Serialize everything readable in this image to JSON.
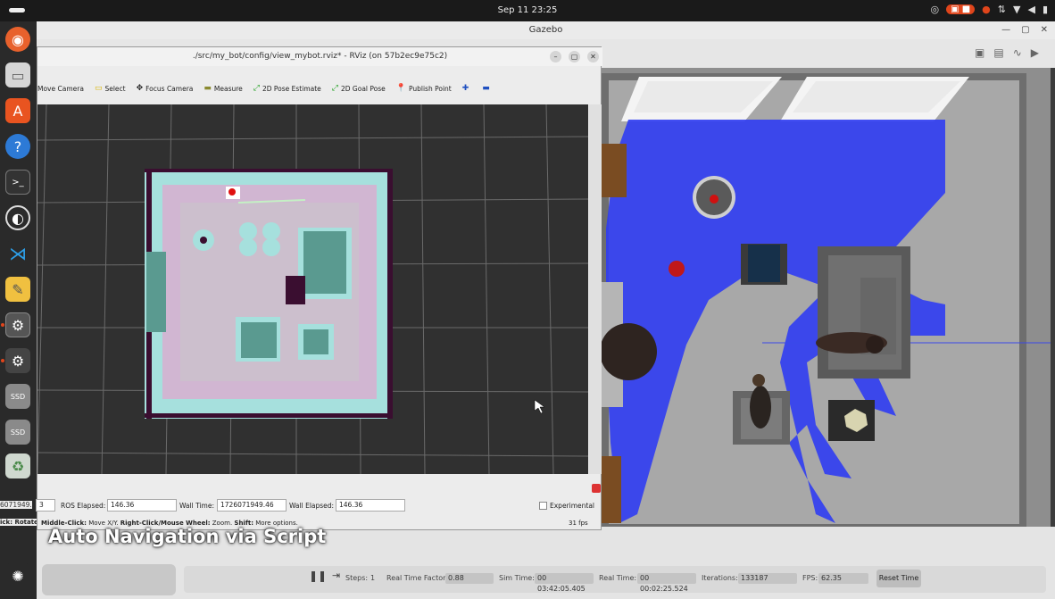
{
  "system": {
    "clock": "Sep 11  23:25",
    "tray_icons": [
      "chrome-icon",
      "screen-record-icon",
      "mic-icon",
      "network-icon",
      "wifi-icon",
      "volume-icon",
      "battery-icon"
    ]
  },
  "dock": {
    "apps": [
      "firefox-icon",
      "files-icon",
      "app-center-icon",
      "help-icon",
      "terminal-icon",
      "obs-icon",
      "vscode-icon",
      "text-editor-icon",
      "settings-icon",
      "settings-icon-2",
      "ssd-drive-icon",
      "ssd-drive-icon-2",
      "trash-icon",
      "ubuntu-apps-icon"
    ],
    "ssd_label": "SSD"
  },
  "gazebo": {
    "title": "Gazebo",
    "bottom_bar": {
      "steps_label": "Steps:",
      "steps_value": "1",
      "rtf_label": "Real Time Factor:",
      "rtf_value": "0.88",
      "sim_time_label": "Sim Time:",
      "sim_time_value": "00 03:42:05.405",
      "real_time_label": "Real Time:",
      "real_time_value": "00 00:02:25.524",
      "iterations_label": "Iterations:",
      "iterations_value": "133187",
      "fps_label": "FPS:",
      "fps_value": "62.35",
      "reset_label": "Reset Time"
    }
  },
  "rviz": {
    "title": "./src/my_bot/config/view_mybot.rviz* - RViz (on 57b2ec9e75c2)",
    "tools": [
      {
        "icon": "move-camera-icon",
        "label": "Move Camera"
      },
      {
        "icon": "select-icon",
        "label": "Select"
      },
      {
        "icon": "focus-camera-icon",
        "label": "Focus Camera"
      },
      {
        "icon": "measure-icon",
        "label": "Measure"
      },
      {
        "icon": "pose-estimate-icon",
        "label": "2D Pose Estimate"
      },
      {
        "icon": "goal-pose-icon",
        "label": "2D Goal Pose"
      },
      {
        "icon": "publish-point-icon",
        "label": "Publish Point"
      }
    ],
    "time": {
      "partial_value": "3",
      "ros_elapsed_label": "ROS Elapsed:",
      "ros_elapsed_value": "146.36",
      "wall_time_label": "Wall Time:",
      "wall_time_value": "1726071949.46",
      "wall_elapsed_label": "Wall Elapsed:",
      "wall_elapsed_value": "146.36",
      "experimental_label": "Experimental",
      "left_partial": "6071949.4"
    },
    "status": {
      "hint_prefix": "ick: Rotate.",
      "middle_click": "Middle-Click:",
      "middle_text": "Move X/Y.",
      "right_click": "Right-Click/Mouse Wheel:",
      "right_text": "Zoom.",
      "shift": "Shift:",
      "shift_text": "More options.",
      "fps": "31 fps"
    }
  },
  "caption": "Auto Navigation via Script"
}
